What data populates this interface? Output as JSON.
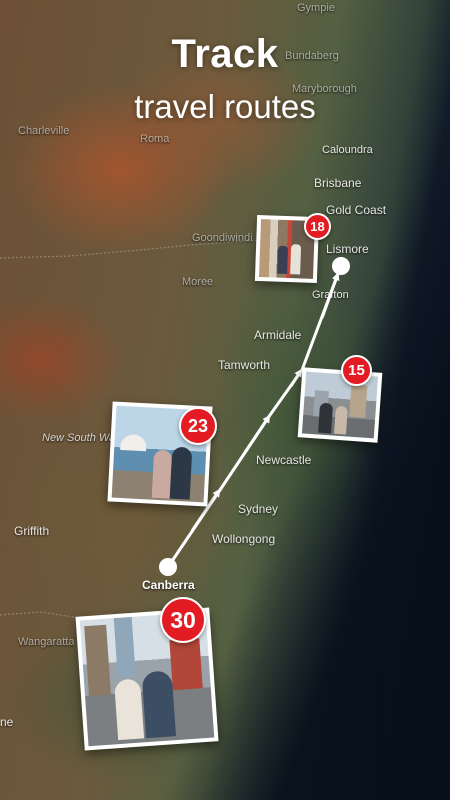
{
  "headline": {
    "line1": "Track",
    "line2": "travel routes"
  },
  "map": {
    "places": {
      "bundaberg": "Bundaberg",
      "maryborough": "Maryborough",
      "gympie": "Gympie",
      "charleville": "Charleville",
      "roma": "Roma",
      "caloundra": "Caloundra",
      "brisbane": "Brisbane",
      "gold_coast": "Gold Coast",
      "goondiwindi": "Goondiwindi",
      "lismore": "Lismore",
      "moree": "Moree",
      "grafton": "Grafton",
      "armidale": "Armidale",
      "tamworth": "Tamworth",
      "new_south_wales": "New South Wa",
      "newcastle": "Newcastle",
      "sydney": "Sydney",
      "griffith": "Griffith",
      "wollongong": "Wollongong",
      "canberra": "Canberra",
      "wangaratta": "Wangaratta",
      "partial_left": "ne"
    }
  },
  "photos": [
    {
      "badge": "18"
    },
    {
      "badge": "15"
    },
    {
      "badge": "23"
    },
    {
      "badge": "30"
    }
  ],
  "colors": {
    "badge": "#e31b23",
    "route": "#ffffff"
  }
}
